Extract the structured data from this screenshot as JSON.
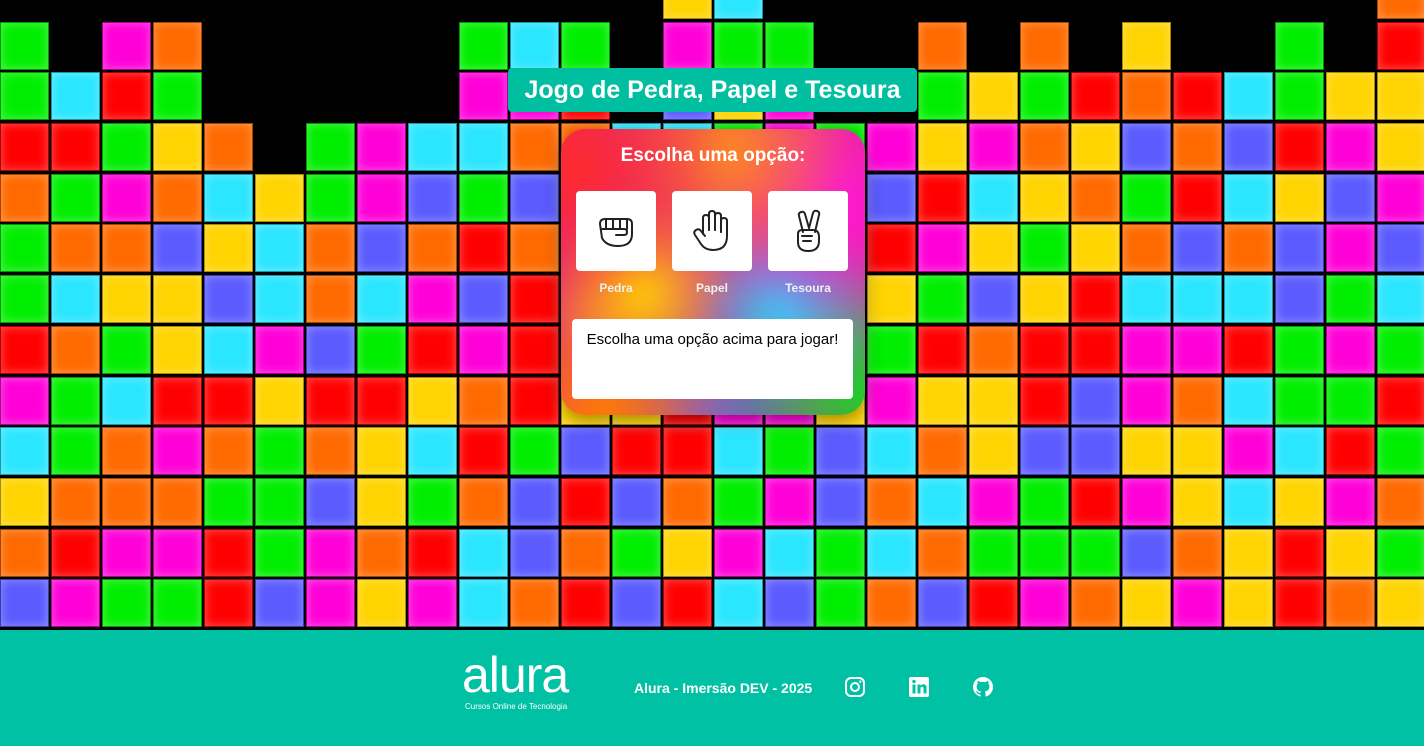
{
  "page": {
    "title": "Jogo de Pedra, Papel e Tesoura"
  },
  "game": {
    "heading": "Escolha uma opção:",
    "choices": [
      {
        "label": "Pedra",
        "icon": "fist-icon"
      },
      {
        "label": "Papel",
        "icon": "open-hand-icon"
      },
      {
        "label": "Tesoura",
        "icon": "peace-hand-icon"
      }
    ],
    "result": "Escolha uma opção acima para jogar!"
  },
  "footer": {
    "logo_word": "alura",
    "logo_tagline": "Cursos Online de Tecnologia",
    "text": "Alura - Imersão DEV - 2025",
    "social": [
      "instagram-icon",
      "linkedin-icon",
      "github-icon"
    ]
  },
  "colors": {
    "accent": "#00c1a3",
    "tile_palette": [
      "#ff0000",
      "#ff6a00",
      "#ffd400",
      "#00ee00",
      "#2ae6ff",
      "#5b5bff",
      "#ff00d8"
    ]
  }
}
